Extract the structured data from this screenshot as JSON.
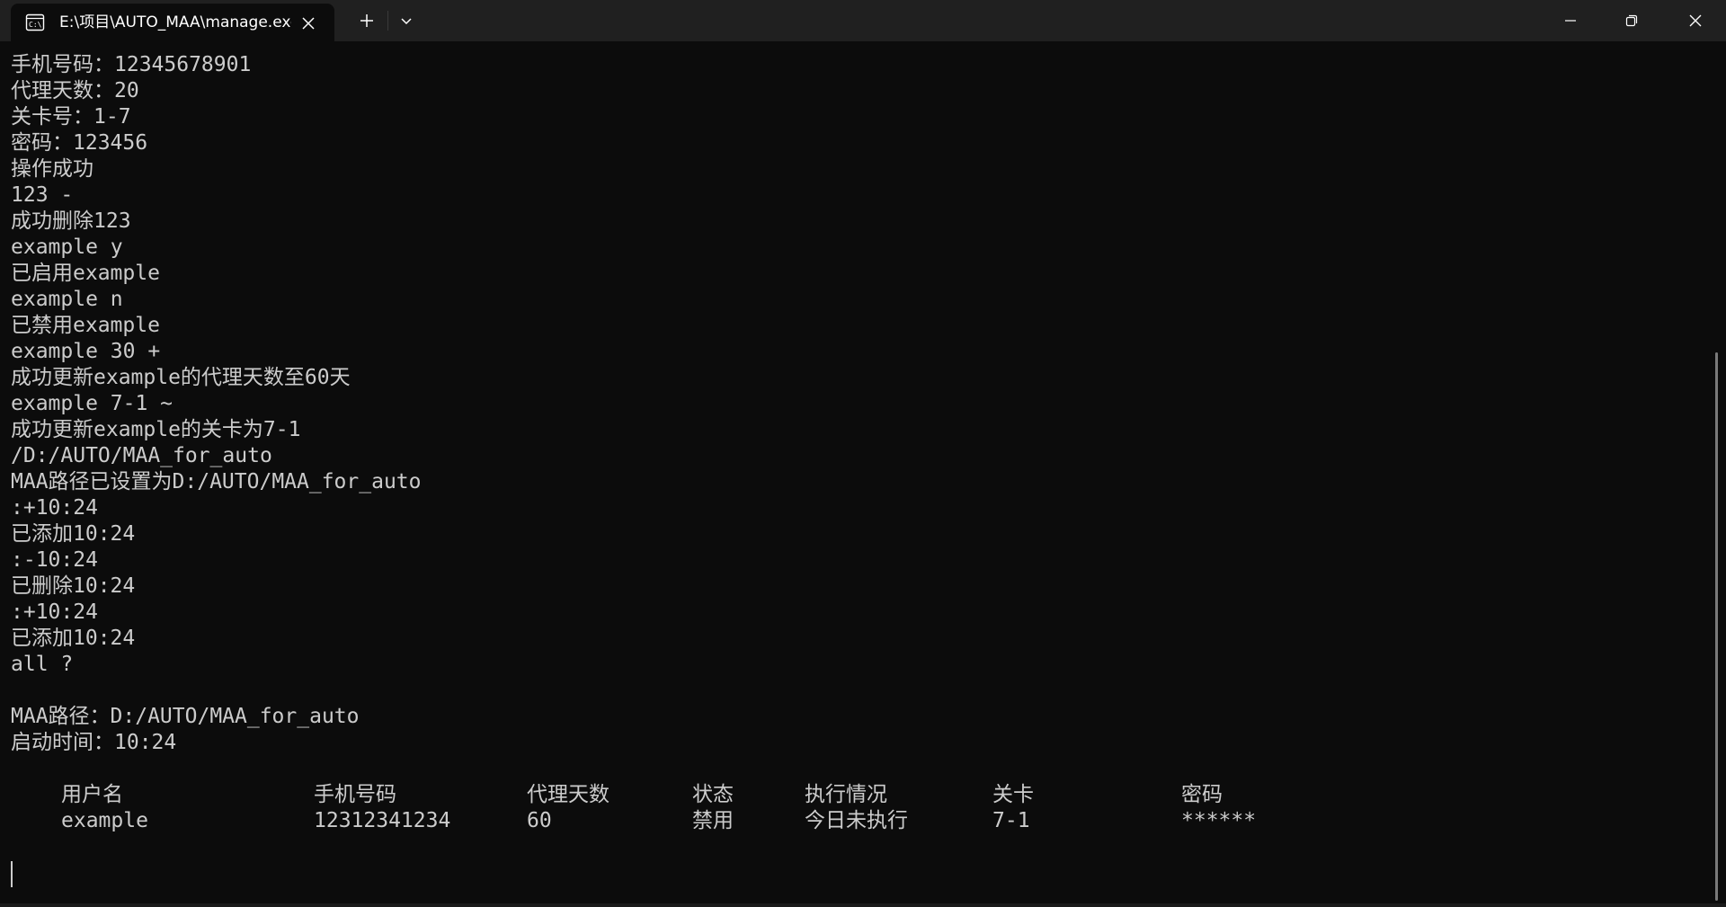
{
  "window": {
    "tab_title": "E:\\项目\\AUTO_MAA\\manage.exe",
    "icons": {
      "tab": "terminal-icon",
      "tab_close": "close-icon",
      "new_tab": "plus-icon",
      "dropdown": "chevron-down-icon",
      "minimize": "minimize-icon",
      "restore": "restore-icon",
      "close": "close-icon"
    }
  },
  "colors": {
    "background": "#0c0c0c",
    "titlebar": "#202020",
    "text": "#cccccc"
  },
  "console": {
    "lines": [
      "手机号码：12345678901",
      "代理天数：20",
      "关卡号：1-7",
      "密码：123456",
      "操作成功",
      "123 -",
      "成功删除123",
      "example y",
      "已启用example",
      "example n",
      "已禁用example",
      "example 30 +",
      "成功更新example的代理天数至60天",
      "example 7-1 ~",
      "成功更新example的关卡为7-1",
      "/D:/AUTO/MAA_for_auto",
      "MAA路径已设置为D:/AUTO/MAA_for_auto",
      ":+10:24",
      "已添加10:24",
      ":-10:24",
      "已删除10:24",
      ":+10:24",
      "已添加10:24",
      "all ?",
      "",
      "MAA路径：D:/AUTO/MAA_for_auto",
      "启动时间：10:24"
    ],
    "table": {
      "headers": [
        "用户名",
        "手机号码",
        "代理天数",
        "状态",
        "执行情况",
        "关卡",
        "密码"
      ],
      "rows": [
        [
          "example",
          "12312341234",
          "60",
          "禁用",
          "今日未执行",
          "7-1",
          "******"
        ]
      ]
    }
  }
}
